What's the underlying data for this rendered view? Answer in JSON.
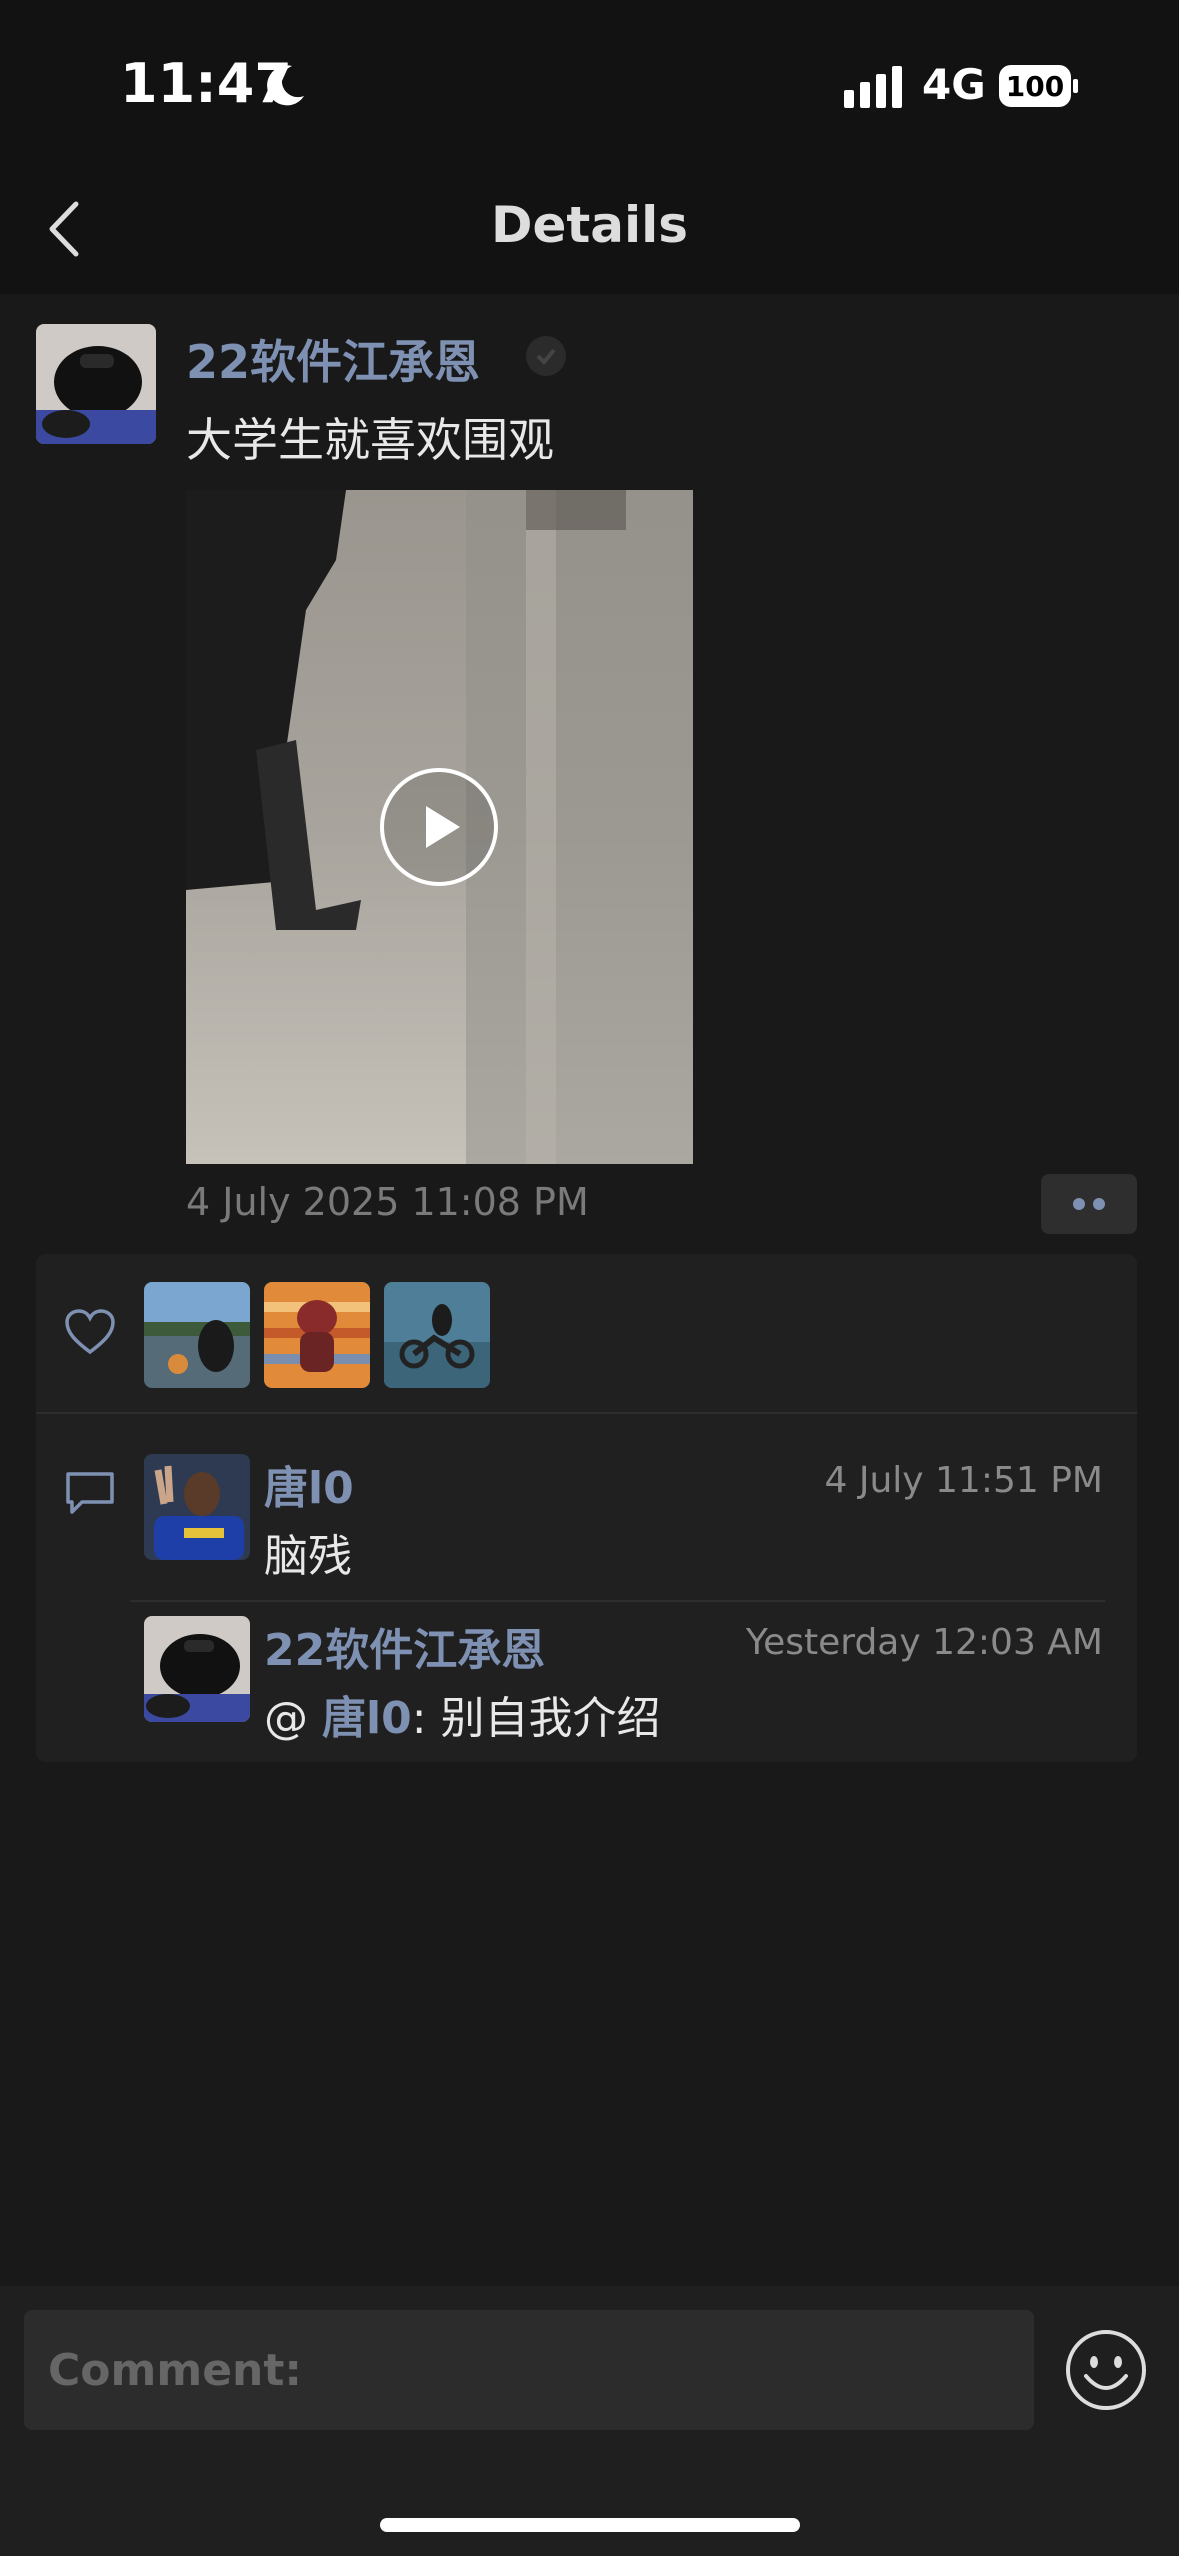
{
  "status_bar": {
    "time": "11:47",
    "network": "4G",
    "battery": "100"
  },
  "nav": {
    "title": "Details"
  },
  "post": {
    "author": "22软件江承恩",
    "text": "大学生就喜欢围观",
    "time": "4 July 2025 11:08 PM"
  },
  "likes": {
    "avatars": [
      "lake-campfire-avatar",
      "bear-avatar",
      "motorbike-avatar"
    ]
  },
  "comments": [
    {
      "author": "唐l0",
      "time": "4 July  11:51 PM",
      "text": "脑残"
    },
    {
      "author": "22软件江承恩",
      "time": "Yesterday 12:03 AM",
      "mention_prefix": "@ ",
      "mention": "唐l0",
      "text": ": 别自我介绍"
    }
  ],
  "composer": {
    "placeholder": "Comment:"
  },
  "colors": {
    "name_blue": "#7f91b3",
    "background": "#191919",
    "card": "#202020"
  }
}
